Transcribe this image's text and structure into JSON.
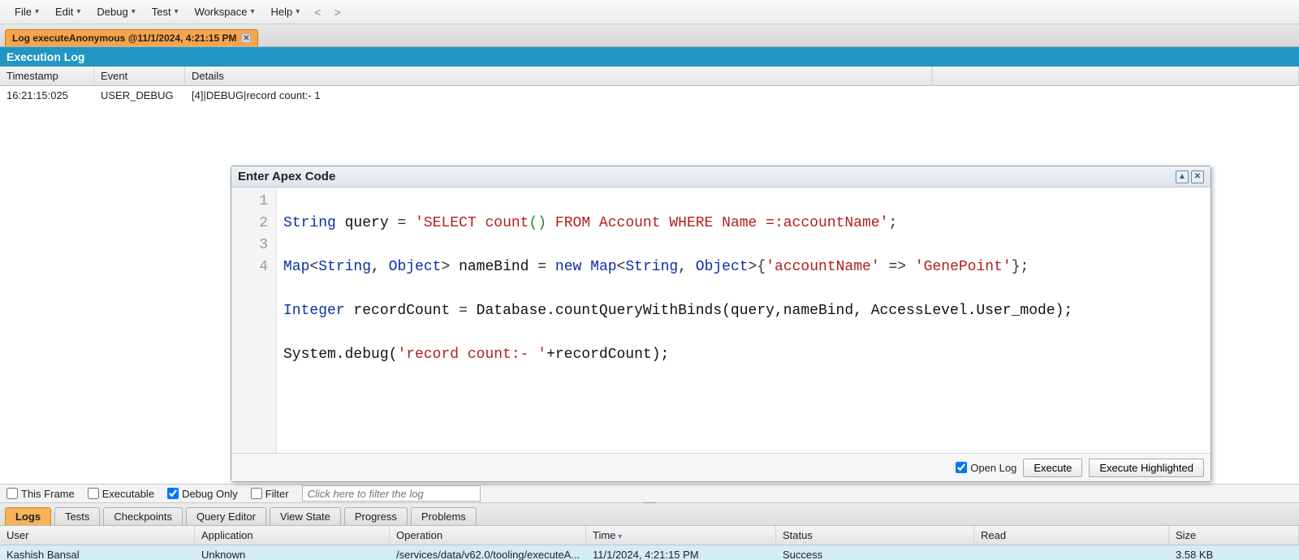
{
  "menu": {
    "file": "File",
    "edit": "Edit",
    "debug": "Debug",
    "test": "Test",
    "workspace": "Workspace",
    "help": "Help"
  },
  "file_tab": {
    "label": "Log executeAnonymous @11/1/2024, 4:21:15 PM"
  },
  "exec_log": {
    "title": "Execution Log",
    "cols": {
      "ts": "Timestamp",
      "ev": "Event",
      "det": "Details"
    },
    "row": {
      "ts": "16:21:15:025",
      "ev": "USER_DEBUG",
      "det": "[4]|DEBUG|record count:- 1"
    }
  },
  "filters": {
    "this_frame": {
      "label": "This Frame",
      "checked": false
    },
    "executable": {
      "label": "Executable",
      "checked": false
    },
    "debug_only": {
      "label": "Debug Only",
      "checked": true
    },
    "filter": {
      "label": "Filter",
      "checked": false
    },
    "placeholder": "Click here to filter the log"
  },
  "bottom_tabs": {
    "logs": "Logs",
    "tests": "Tests",
    "checkpoints": "Checkpoints",
    "query": "Query Editor",
    "view_state": "View State",
    "progress": "Progress",
    "problems": "Problems"
  },
  "logs_grid": {
    "cols": {
      "user": "User",
      "app": "Application",
      "op": "Operation",
      "time": "Time",
      "status": "Status",
      "read": "Read",
      "size": "Size"
    },
    "row": {
      "user": "Kashish Bansal",
      "app": "Unknown",
      "op": "/services/data/v62.0/tooling/executeA...",
      "time": "11/1/2024, 4:21:15 PM",
      "status": "Success",
      "read": "",
      "size": "3.58 KB"
    }
  },
  "dialog": {
    "title": "Enter Apex Code",
    "open_log": "Open Log",
    "execute": "Execute",
    "execute_hl": "Execute Highlighted",
    "open_log_checked": true,
    "lines": [
      "1",
      "2",
      "3",
      "4"
    ],
    "code": {
      "l1": {
        "a": "String",
        "b": " query ",
        "c": "=",
        "d": " ",
        "e": "'SELECT count",
        "f": "()",
        "g": " FROM Account WHERE Name =:accountName'",
        "h": ";"
      },
      "l2": {
        "a": "Map",
        "b": "<",
        "c": "String",
        "d": ", ",
        "e": "Object",
        "f": ">",
        "g": " nameBind ",
        "h": "=",
        "i": " ",
        "j": "new",
        "k": " ",
        "l": "Map",
        "m": "<",
        "n": "String",
        "o": ", ",
        "p": "Object",
        "q": ">",
        "r": "{",
        "s": "'accountName'",
        "t": " => ",
        "u": "'GenePoint'",
        "v": "}",
        "w": ";"
      },
      "l3": {
        "a": "Integer",
        "b": " recordCount ",
        "c": "=",
        "d": " Database.countQueryWithBinds(query,nameBind, AccessLevel.User_mode);"
      },
      "l4": {
        "a": "System.debug(",
        "b": "'record count:- '",
        "c": "+recordCount);"
      }
    }
  }
}
